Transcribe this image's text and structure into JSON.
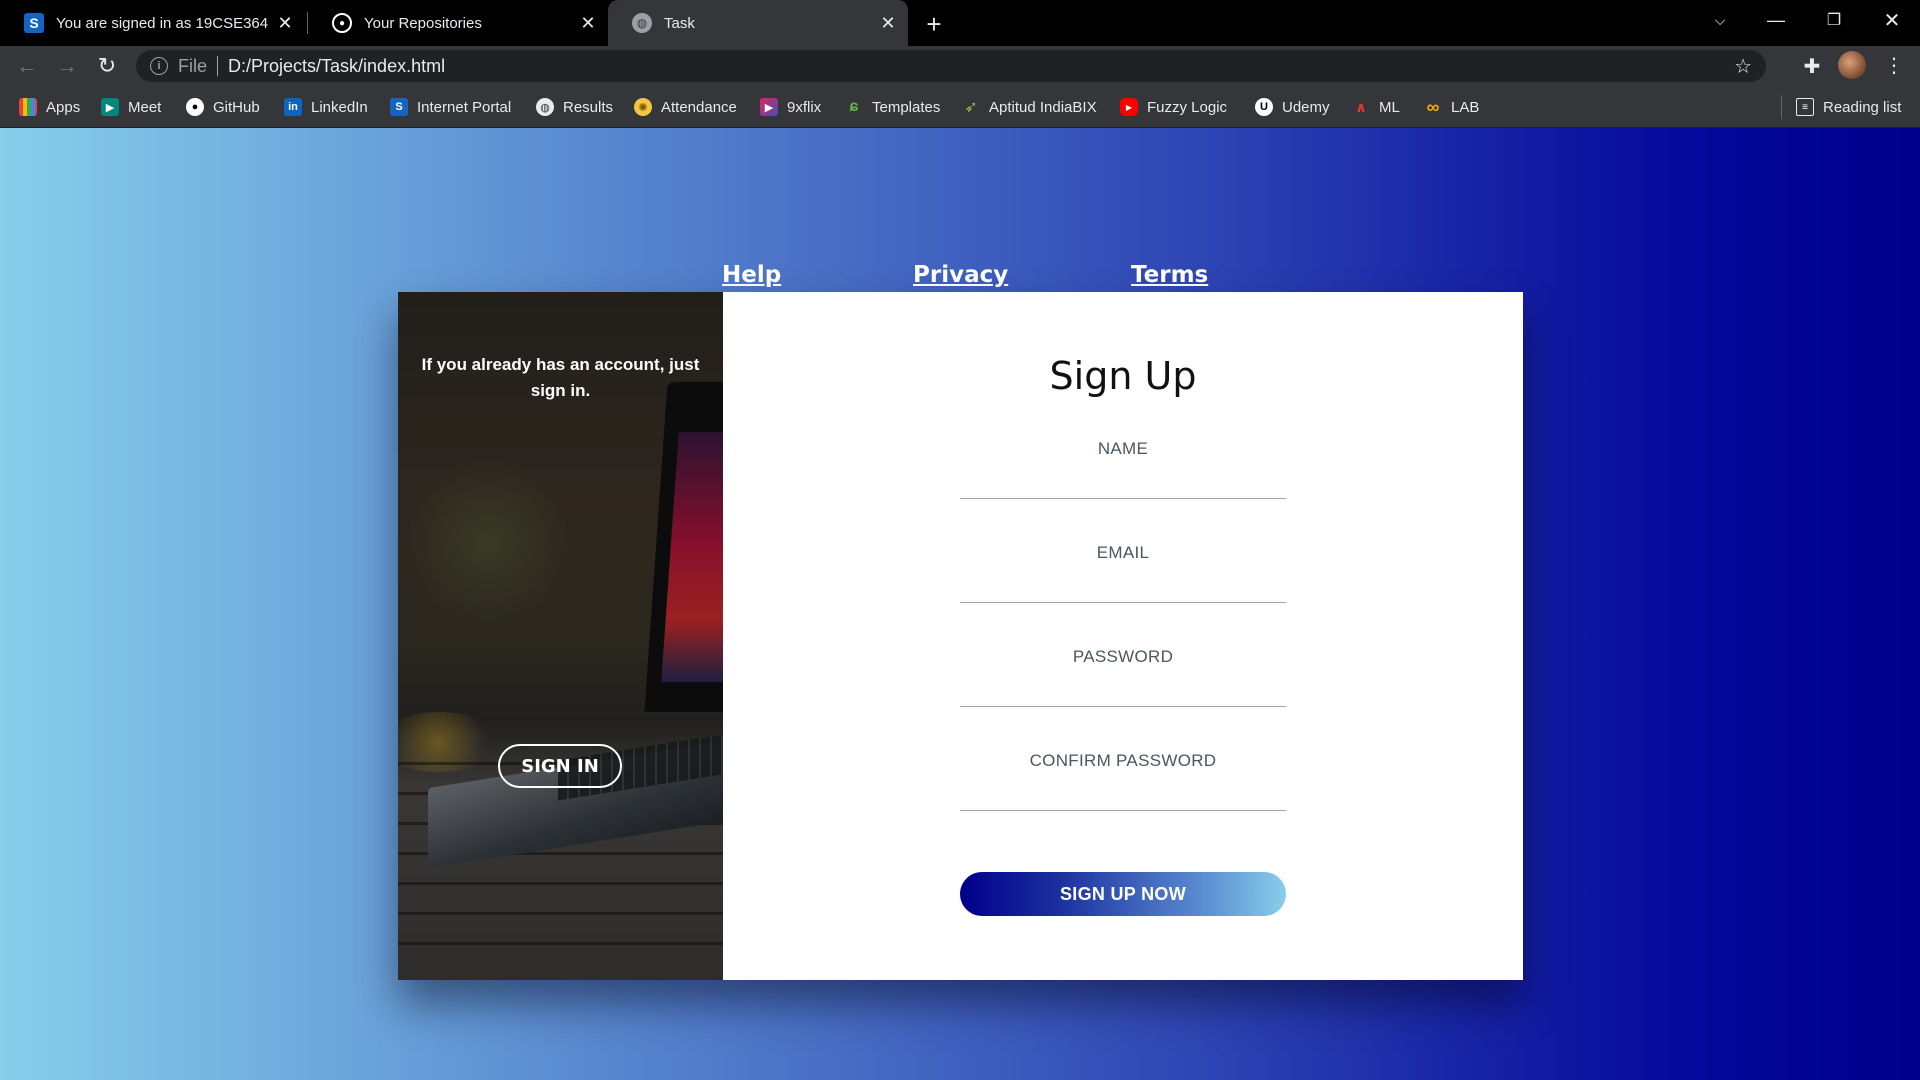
{
  "browser": {
    "tabs": [
      {
        "title": "You are signed in as 19CSE364",
        "icon": "s-brand-icon",
        "active": false
      },
      {
        "title": "Your Repositories",
        "icon": "github-icon",
        "active": false
      },
      {
        "title": "Task",
        "icon": "globe-icon",
        "active": true
      }
    ],
    "address": {
      "scheme": "File",
      "url": "D:/Projects/Task/index.html"
    },
    "bookmarks": [
      {
        "label": "Apps",
        "icon": "apps-grid-icon"
      },
      {
        "label": "Meet",
        "icon": "meet-icon"
      },
      {
        "label": "GitHub",
        "icon": "github-icon"
      },
      {
        "label": "LinkedIn",
        "icon": "linkedin-icon"
      },
      {
        "label": "Internet Portal",
        "icon": "s-brand-icon"
      },
      {
        "label": "Results",
        "icon": "globe-icon"
      },
      {
        "label": "Attendance",
        "icon": "attendance-icon"
      },
      {
        "label": "9xflix",
        "icon": "play-icon"
      },
      {
        "label": "Templates",
        "icon": "leaf-icon"
      },
      {
        "label": "Aptitud IndiaBIX",
        "icon": "feather-icon"
      },
      {
        "label": "Fuzzy Logic",
        "icon": "youtube-icon"
      },
      {
        "label": "Udemy",
        "icon": "udemy-icon"
      },
      {
        "label": "ML",
        "icon": "ml-icon"
      },
      {
        "label": "LAB",
        "icon": "infinity-icon"
      }
    ],
    "reading_list": "Reading list"
  },
  "page": {
    "links": [
      "Help",
      "Privacy",
      "Terms"
    ],
    "left_panel": {
      "message": "If you already has an account, just sign in.",
      "signin_label": "SIGN IN"
    },
    "form": {
      "title": "Sign Up",
      "fields": [
        {
          "label": "NAME",
          "value": ""
        },
        {
          "label": "EMAIL",
          "value": ""
        },
        {
          "label": "PASSWORD",
          "value": ""
        },
        {
          "label": "CONFIRM PASSWORD",
          "value": ""
        }
      ],
      "submit_label": "SIGN UP NOW"
    }
  },
  "colors": {
    "gradient_start": "#87ceeb",
    "gradient_end": "#00008b",
    "browser_frame": "#35363a",
    "tabstrip": "#000000"
  }
}
